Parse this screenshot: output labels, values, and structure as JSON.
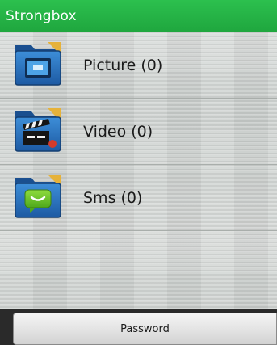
{
  "app": {
    "title": "Strongbox",
    "accent_color": "#22b247"
  },
  "list": {
    "items": [
      {
        "label": "Picture (0)",
        "icon": "picture-folder-icon"
      },
      {
        "label": "Video (0)",
        "icon": "video-folder-icon"
      },
      {
        "label": "Sms (0)",
        "icon": "sms-folder-icon"
      }
    ]
  },
  "footer": {
    "password_label": "Password"
  }
}
